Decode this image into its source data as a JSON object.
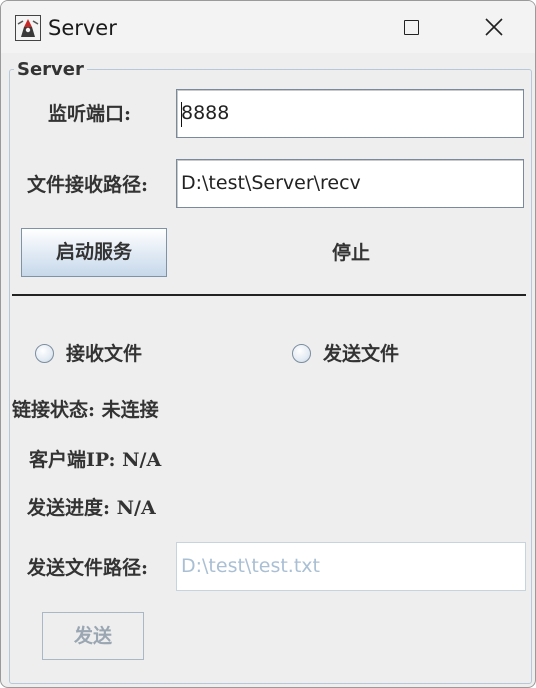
{
  "window": {
    "title": "Server"
  },
  "server_group": {
    "title": "Server",
    "port_label": "监听端口:",
    "port_value": "8888",
    "recv_path_label": "文件接收路径:",
    "recv_path_value": "D:\\test\\Server\\recv",
    "start_button": "启动服务",
    "stop_button": "停止"
  },
  "mode": {
    "receive_label": "接收文件",
    "send_label": "发送文件"
  },
  "status": {
    "link_label": "链接状态:",
    "link_value": "未连接",
    "client_ip_label": "客户端IP:",
    "client_ip_value": "N/A",
    "progress_label": "发送进度:",
    "progress_value": "N/A"
  },
  "send": {
    "path_label": "发送文件路径:",
    "path_placeholder": "D:\\test\\test.txt",
    "send_button": "发送"
  }
}
